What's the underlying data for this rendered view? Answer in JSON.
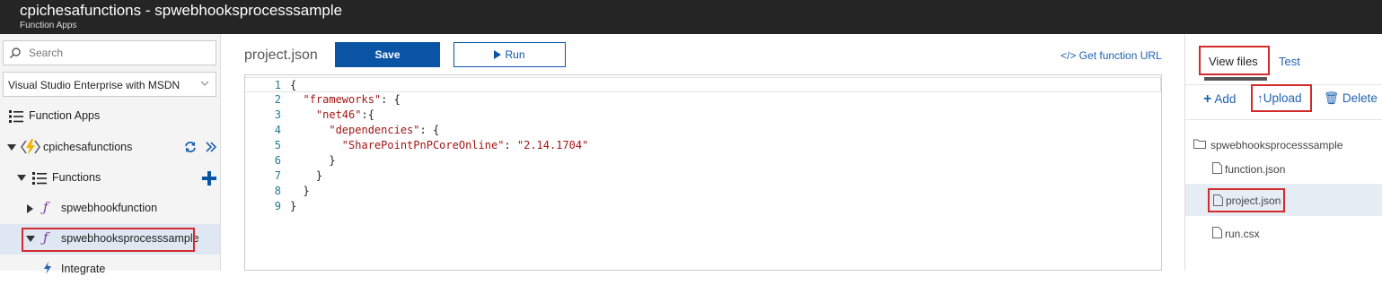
{
  "header": {
    "title": "cpichesafunctions - spwebhooksprocesssample",
    "subtitle": "Function Apps"
  },
  "sidebar": {
    "search_placeholder": "Search",
    "subscription": "Visual Studio Enterprise with MSDN",
    "items": [
      {
        "label": "Function Apps"
      },
      {
        "label": "cpichesafunctions"
      },
      {
        "label": "Functions"
      },
      {
        "label": "spwebhookfunction"
      },
      {
        "label": "spwebhooksprocesssample"
      },
      {
        "label": "Integrate"
      }
    ]
  },
  "editor": {
    "filename": "project.json",
    "save_label": "Save",
    "run_label": "Run",
    "get_url_label": "</> Get function URL",
    "lines": [
      {
        "num": "1",
        "text": "{"
      },
      {
        "num": "2",
        "text": "  \"frameworks\": {"
      },
      {
        "num": "3",
        "text": "    \"net46\":{"
      },
      {
        "num": "4",
        "text": "      \"dependencies\": {"
      },
      {
        "num": "5",
        "text": "        \"SharePointPnPCoreOnline\": \"2.14.1704\""
      },
      {
        "num": "6",
        "text": "      }"
      },
      {
        "num": "7",
        "text": "    }"
      },
      {
        "num": "8",
        "text": "  }"
      },
      {
        "num": "9",
        "text": "}"
      }
    ]
  },
  "rpanel": {
    "tabs": {
      "view_files": "View files",
      "test": "Test"
    },
    "actions": {
      "add": "Add",
      "upload": "Upload",
      "delete": "Delete"
    },
    "folder": "spwebhooksprocesssample",
    "files": [
      "function.json",
      "project.json",
      "run.csx"
    ]
  },
  "colors": {
    "accent": "#0a54a6",
    "link": "#1f62b1",
    "highlight": "#d42a2a",
    "header_bg": "#252525"
  }
}
